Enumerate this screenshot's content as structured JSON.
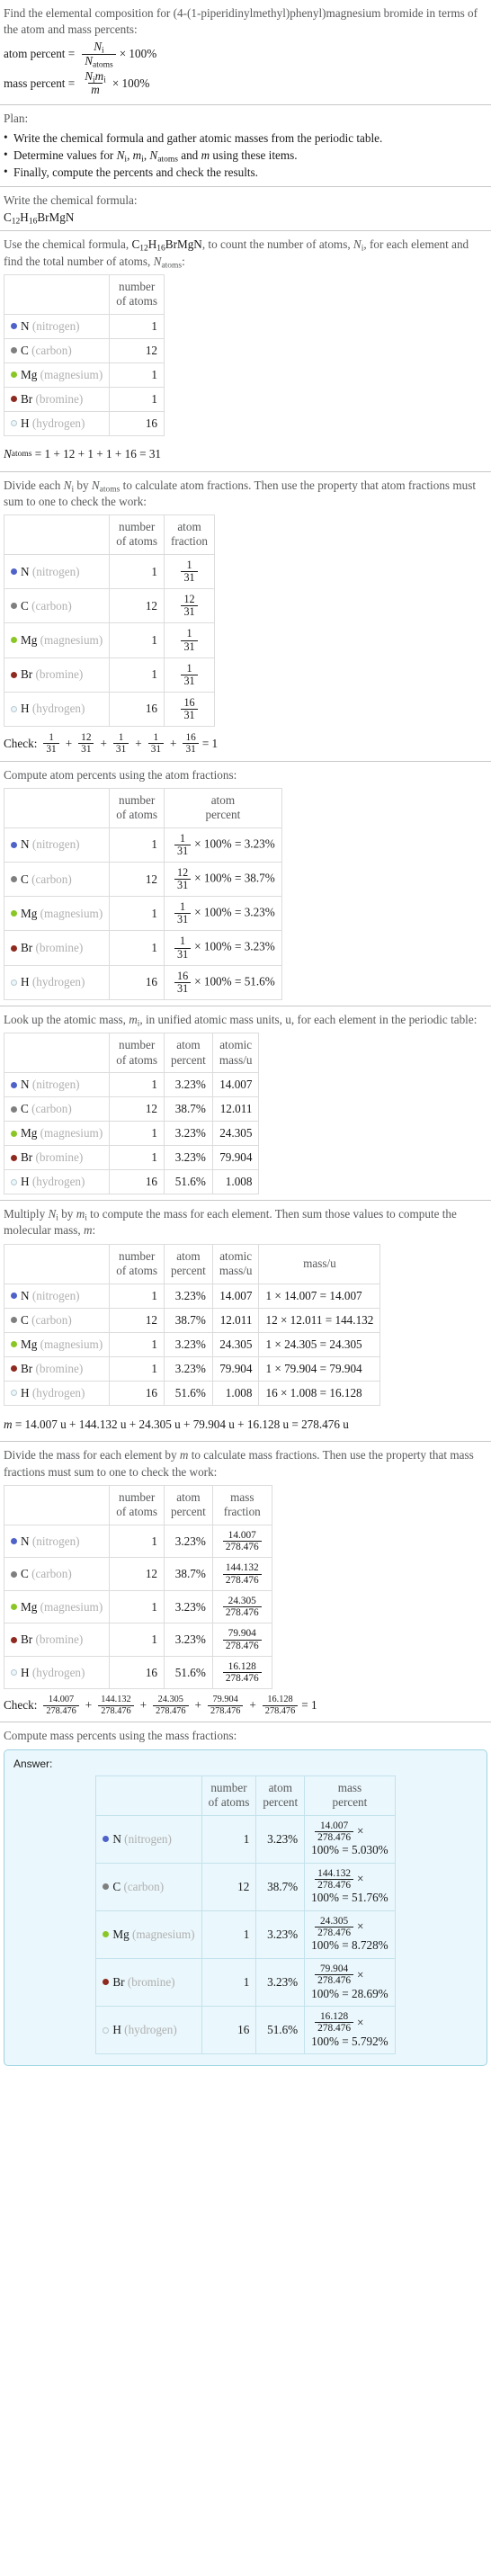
{
  "problem": {
    "statement": "Find the elemental composition for (4-(1-piperidinylmethyl)phenyl)magnesium bromide in terms of the atom and mass percents:",
    "atom_percent_label": "atom percent =",
    "mass_percent_label": "mass percent =",
    "atom_percent_num": "N",
    "atom_percent_num_sub": "i",
    "atom_percent_den": "N",
    "atom_percent_den_sub": "atoms",
    "mass_percent_num": "N",
    "mass_percent_num_sub": "i",
    "mass_percent_num2": "m",
    "mass_percent_num2_sub": "i",
    "mass_percent_den": "m",
    "times_100": "× 100%"
  },
  "plan": {
    "heading": "Plan:",
    "items": [
      "Write the chemical formula and gather atomic masses from the periodic table.",
      "Determine values for Ni, mi, Natoms and m using these items.",
      "Finally, compute the percents and check the results."
    ],
    "item2_parts": {
      "a": "Determine values for ",
      "b": "N",
      "b_sub": "i",
      "c": ", ",
      "d": "m",
      "d_sub": "i",
      "e": ", ",
      "f": "N",
      "f_sub": "atoms",
      "g": " and ",
      "h": "m",
      "i": " using these items."
    }
  },
  "formula_section": {
    "prompt": "Write the chemical formula:",
    "formula_parts": [
      {
        "sym": "C",
        "sub": "12"
      },
      {
        "sym": "H",
        "sub": "16"
      },
      {
        "sym": "Br",
        "sub": ""
      },
      {
        "sym": "Mg",
        "sub": ""
      },
      {
        "sym": "N",
        "sub": ""
      }
    ],
    "formula_plain": "C12H16BrMgN"
  },
  "elements": [
    {
      "symbol": "N",
      "name": "(nitrogen)",
      "color": "#4f62c8",
      "hollow": false,
      "count": "1",
      "fraction_num": "1",
      "fraction_den": "31",
      "atom_percent": "3.23%",
      "atomic_mass": "14.007",
      "mass_expr": "1 × 14.007 = 14.007",
      "mass_num": "14.007",
      "mass_den": "278.476",
      "mass_percent": "5.030%"
    },
    {
      "symbol": "C",
      "name": "(carbon)",
      "color": "#7f7f7f",
      "hollow": false,
      "count": "12",
      "fraction_num": "12",
      "fraction_den": "31",
      "atom_percent": "38.7%",
      "atomic_mass": "12.011",
      "mass_expr": "12 × 12.011 = 144.132",
      "mass_num": "144.132",
      "mass_den": "278.476",
      "mass_percent": "51.76%"
    },
    {
      "symbol": "Mg",
      "name": "(magnesium)",
      "color": "#8ac726",
      "hollow": false,
      "count": "1",
      "fraction_num": "1",
      "fraction_den": "31",
      "atom_percent": "3.23%",
      "atomic_mass": "24.305",
      "mass_expr": "1 × 24.305 = 24.305",
      "mass_num": "24.305",
      "mass_den": "278.476",
      "mass_percent": "8.728%"
    },
    {
      "symbol": "Br",
      "name": "(bromine)",
      "color": "#8e2a20",
      "hollow": false,
      "count": "1",
      "fraction_num": "1",
      "fraction_den": "31",
      "atom_percent": "3.23%",
      "atomic_mass": "79.904",
      "mass_expr": "1 × 79.904 = 79.904",
      "mass_num": "79.904",
      "mass_den": "278.476",
      "mass_percent": "28.69%"
    },
    {
      "symbol": "H",
      "name": "(hydrogen)",
      "color": "#eaf7fb",
      "hollow": true,
      "count": "16",
      "fraction_num": "16",
      "fraction_den": "31",
      "atom_percent": "51.6%",
      "atomic_mass": "1.008",
      "mass_expr": "16 × 1.008 = 16.128",
      "mass_num": "16.128",
      "mass_den": "278.476",
      "mass_percent": "5.792%"
    }
  ],
  "headers": {
    "blank": "",
    "number_of_atoms_l1": "number",
    "number_of_atoms_l2": "of atoms",
    "atom_fraction_l1": "atom",
    "atom_fraction_l2": "fraction",
    "atom_percent_l1": "atom",
    "atom_percent_l2": "percent",
    "atomic_mass_l1": "atomic",
    "atomic_mass_l2": "mass/u",
    "mass_u": "mass/u",
    "mass_fraction_l1": "mass",
    "mass_fraction_l2": "fraction",
    "mass_percent_l1": "mass",
    "mass_percent_l2": "percent"
  },
  "count_section": {
    "prompt_a": "Use the chemical formula, ",
    "prompt_b": "C12H16BrMgN",
    "prompt_c": ", to count the number of atoms, ",
    "prompt_d": "Ni",
    "prompt_e": ", for each element and find the total number of atoms, ",
    "prompt_f": "Natoms",
    "prompt_g": ":",
    "total_label": "N",
    "total_label_sub": "atoms",
    "total_expr": "= 1 + 12 + 1 + 1 + 16 = 31"
  },
  "atom_fraction_section": {
    "prompt": "Divide each Ni by Natoms to calculate atom fractions. Then use the property that atom fractions must sum to one to check the work:",
    "check_label": "Check:",
    "check_terms": [
      {
        "num": "1",
        "den": "31"
      },
      {
        "num": "12",
        "den": "31"
      },
      {
        "num": "1",
        "den": "31"
      },
      {
        "num": "1",
        "den": "31"
      },
      {
        "num": "16",
        "den": "31"
      }
    ],
    "check_result": "= 1"
  },
  "atom_percent_section": {
    "prompt": "Compute atom percents using the atom fractions:"
  },
  "atomic_mass_section": {
    "prompt": "Look up the atomic mass, mi, in unified atomic mass units, u, for each element in the periodic table:"
  },
  "molecular_mass_section": {
    "prompt": "Multiply Ni by mi to compute the mass for each element. Then sum those values to compute the molecular mass, m:",
    "result_label": "m",
    "result_expr": "= 14.007 u + 144.132 u + 24.305 u + 79.904 u + 16.128 u = 278.476 u"
  },
  "mass_fraction_section": {
    "prompt": "Divide the mass for each element by m to calculate mass fractions. Then use the property that mass fractions must sum to one to check the work:",
    "check_label": "Check:",
    "check_terms": [
      {
        "num": "14.007",
        "den": "278.476"
      },
      {
        "num": "144.132",
        "den": "278.476"
      },
      {
        "num": "24.305",
        "den": "278.476"
      },
      {
        "num": "79.904",
        "den": "278.476"
      },
      {
        "num": "16.128",
        "den": "278.476"
      }
    ],
    "check_result": "= 1"
  },
  "mass_percent_section": {
    "prompt": "Compute mass percents using the mass fractions:",
    "answer_label": "Answer:",
    "times": "×",
    "suffix": "100% ="
  },
  "symbols": {
    "times": "×",
    "plus": "+",
    "equals": "=",
    "percent_100": "100%",
    "times_100_eq": "× 100% ="
  },
  "colors": {
    "answer_bg": "#eaf7fc",
    "answer_border": "#9fd4e2",
    "rule": "#c8c8c8",
    "text": "#1a1a1a",
    "muted": "#58595b",
    "element_name": "#b0b0b0"
  }
}
